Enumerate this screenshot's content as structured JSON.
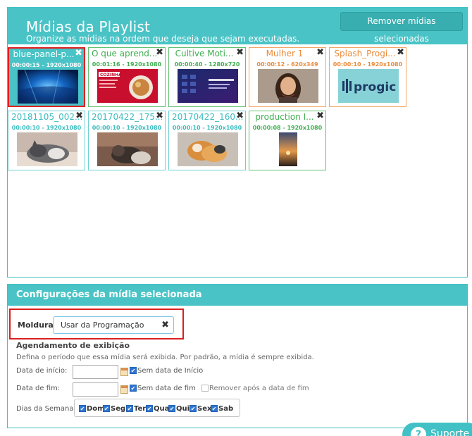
{
  "playlist": {
    "title": "Mídias da Playlist",
    "subtitle": "Organize as mídias na ordem que deseja que sejam executadas.",
    "remove_button": "Remover mídias selecionadas",
    "collapse_glyph": "»",
    "close_glyph": "✖",
    "media": [
      {
        "name": "blue-panel-p...",
        "meta": "00:00:15 - 1920x1080",
        "color": "teal",
        "selected": true
      },
      {
        "name": "O que aprend...",
        "meta": "00:01:16 - 1920x1080",
        "color": "green",
        "selected": false
      },
      {
        "name": "Cultive Moti...",
        "meta": "00:00:40 - 1280x720",
        "color": "green",
        "selected": false
      },
      {
        "name": "Mulher 1",
        "meta": "00:00:12 - 620x349",
        "color": "orange",
        "selected": false
      },
      {
        "name": "Splash_Progi...",
        "meta": "00:00:10 - 1920x1080",
        "color": "orange",
        "selected": false
      },
      {
        "name": "20181105_002...",
        "meta": "00:00:10 - 1920x1080",
        "color": "teal",
        "selected": false
      },
      {
        "name": "20170422_175...",
        "meta": "00:00:10 - 1920x1080",
        "color": "teal",
        "selected": false
      },
      {
        "name": "20170422_160...",
        "meta": "00:00:10 - 1920x1080",
        "color": "teal",
        "selected": false
      },
      {
        "name": "production I...",
        "meta": "00:00:08 - 1920x1080",
        "color": "green",
        "selected": false
      }
    ],
    "thumb_texts": {
      "cozinhar": "COZINHAR",
      "progic": "progic"
    }
  },
  "config": {
    "title": "Configurações da mídia selecionada",
    "moldura_label": "Moldura:",
    "moldura_value": "Usar da Programação",
    "schedule_title": "Agendamento de exibição",
    "schedule_desc": "Defina o período que essa mídia será exibida. Por padrão, a mídia é sempre exibida.",
    "start_label": "Data de início:",
    "start_value": "",
    "no_start_label": "Sem data de Início",
    "end_label": "Data de fim:",
    "end_value": "",
    "no_end_label": "Sem data de fim",
    "remove_after_label": "Remover após a data de fim",
    "days_label": "Dias da Semana:",
    "days": [
      "Dom",
      "Seg",
      "Ter",
      "Qua",
      "Qui",
      "Sex",
      "Sab"
    ],
    "check_glyph": "✔"
  },
  "support": {
    "label": "Suporte",
    "icon_glyph": "?"
  },
  "colors": {
    "teal": "#49c3c6",
    "green": "#3fae4f",
    "orange": "#e98b3a",
    "highlight": "#e02020"
  }
}
